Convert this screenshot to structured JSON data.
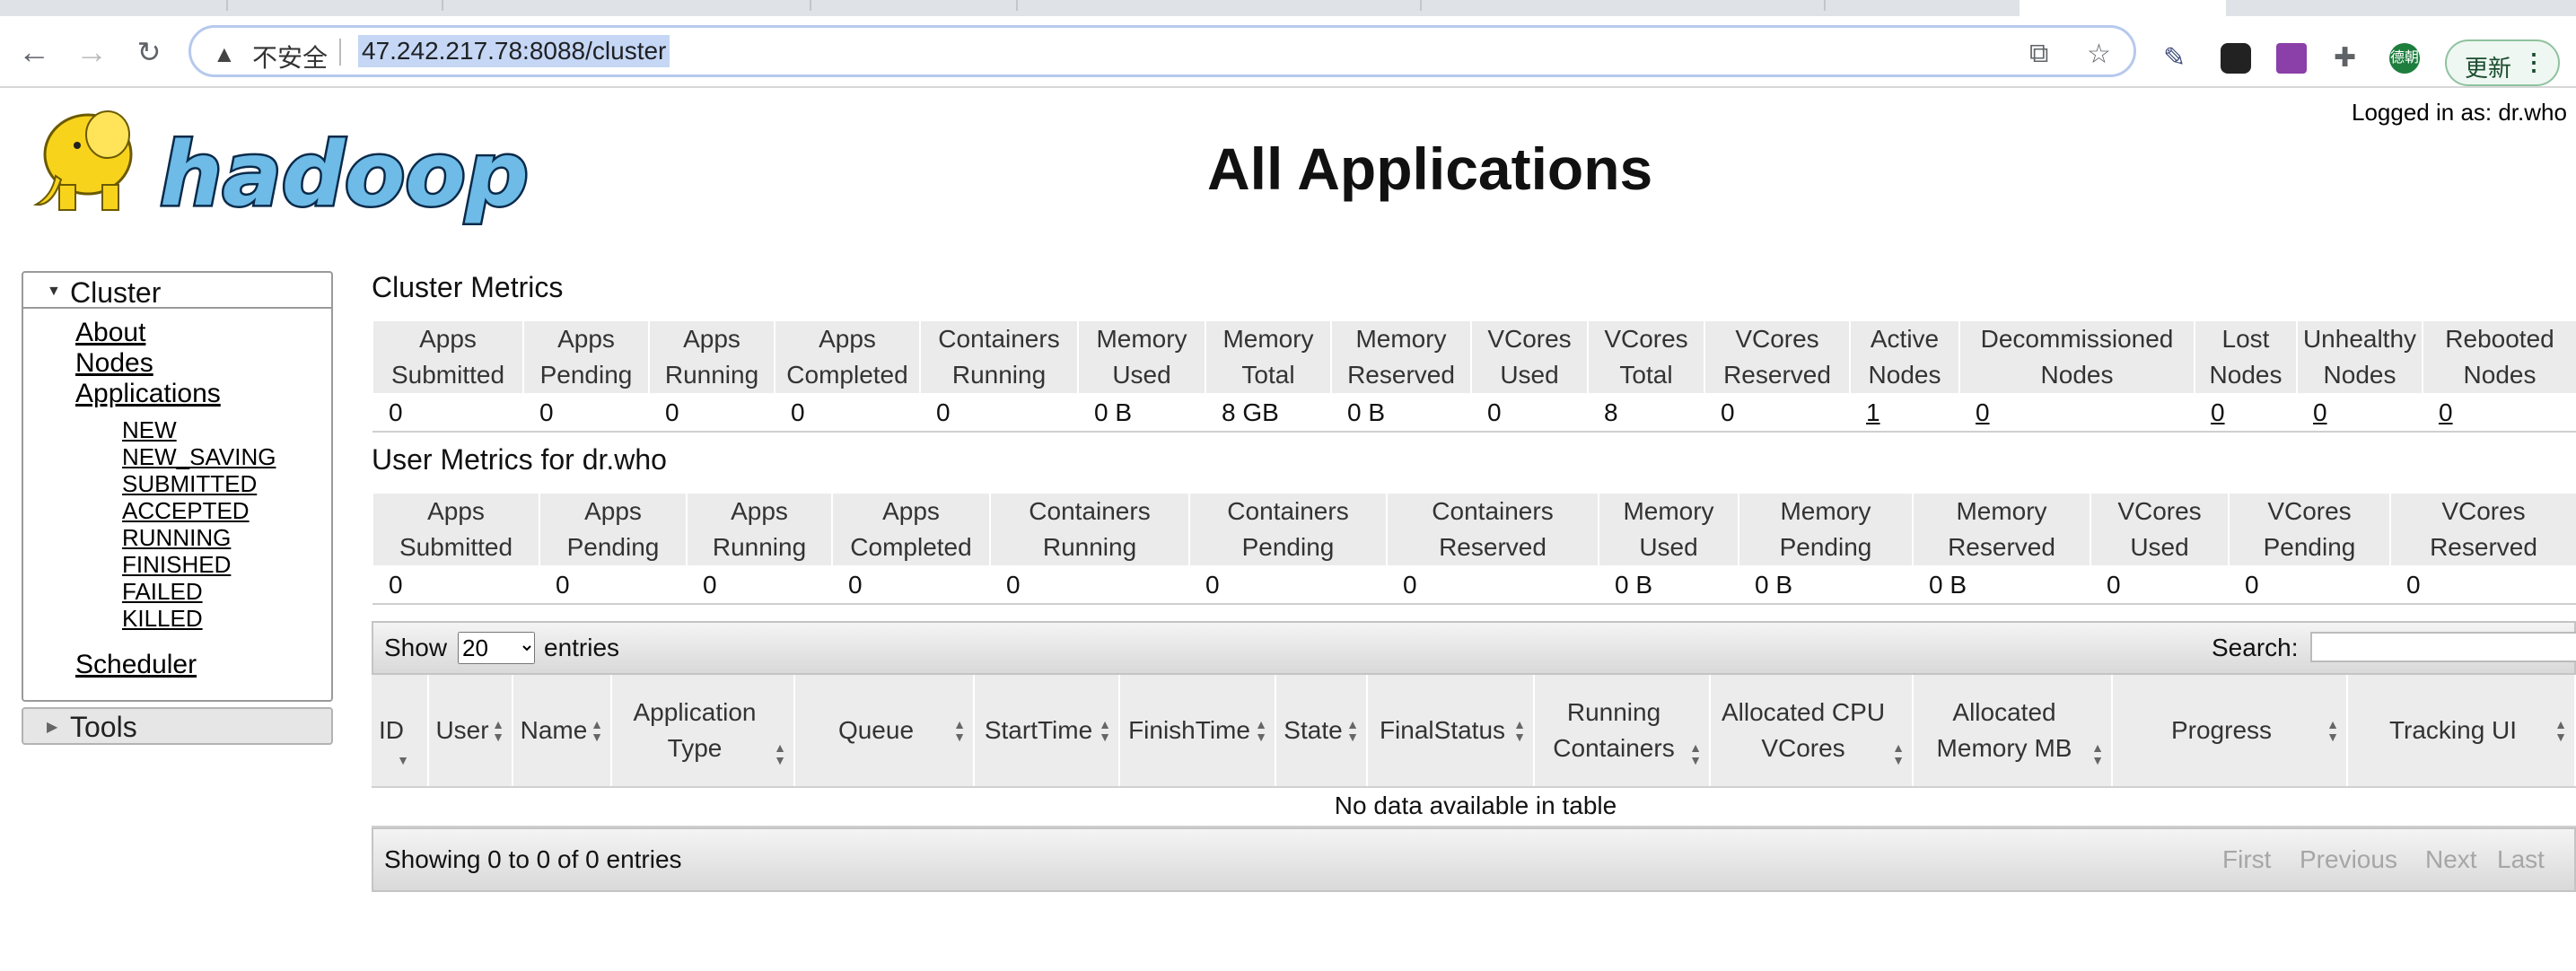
{
  "browser": {
    "insecure_label": "不安全",
    "url": "47.242.217.78:8088/cluster",
    "profile_label": "德朝",
    "update_label": "更新",
    "colors": {
      "omnibox_border": "#b6c9ee",
      "update_bg": "#eef7f1"
    }
  },
  "header": {
    "logged_in": "Logged in as: dr.who",
    "title": "All Applications",
    "logo_text": "hadoop"
  },
  "sidebar": {
    "cluster_label": "Cluster",
    "links": [
      "About",
      "Nodes",
      "Applications"
    ],
    "app_states": [
      "NEW",
      "NEW_SAVING",
      "SUBMITTED",
      "ACCEPTED",
      "RUNNING",
      "FINISHED",
      "FAILED",
      "KILLED"
    ],
    "scheduler": "Scheduler",
    "tools_label": "Tools"
  },
  "cluster_metrics": {
    "title": "Cluster Metrics",
    "headers": [
      "Apps\nSubmitted",
      "Apps\nPending",
      "Apps\nRunning",
      "Apps\nCompleted",
      "Containers\nRunning",
      "Memory\nUsed",
      "Memory\nTotal",
      "Memory\nReserved",
      "VCores\nUsed",
      "VCores\nTotal",
      "VCores\nReserved",
      "Active\nNodes",
      "Decommissioned\nNodes",
      "Lost\nNodes",
      "Unhealthy\nNodes",
      "Rebooted\nNodes"
    ],
    "values": [
      "0",
      "0",
      "0",
      "0",
      "0",
      "0 B",
      "8 GB",
      "0 B",
      "0",
      "8",
      "0",
      "1",
      "0",
      "0",
      "0",
      "0"
    ]
  },
  "user_metrics": {
    "title": "User Metrics for dr.who",
    "headers": [
      "Apps\nSubmitted",
      "Apps\nPending",
      "Apps\nRunning",
      "Apps\nCompleted",
      "Containers\nRunning",
      "Containers\nPending",
      "Containers\nReserved",
      "Memory\nUsed",
      "Memory\nPending",
      "Memory\nReserved",
      "VCores\nUsed",
      "VCores\nPending",
      "VCores\nReserved"
    ],
    "values": [
      "0",
      "0",
      "0",
      "0",
      "0",
      "0",
      "0",
      "0 B",
      "0 B",
      "0 B",
      "0",
      "0",
      "0"
    ]
  },
  "apps_table": {
    "show_label": "Show",
    "page_size": "20",
    "entries_label": "entries",
    "search_label": "Search:",
    "columns": [
      "ID",
      "User",
      "Name",
      "Application\nType",
      "Queue",
      "StartTime",
      "FinishTime",
      "State",
      "FinalStatus",
      "Running\nContainers",
      "Allocated CPU\nVCores",
      "Allocated\nMemory MB",
      "Progress",
      "Tracking UI"
    ],
    "empty_message": "No data available in table",
    "info": "Showing 0 to 0 of 0 entries",
    "pagination": [
      "First",
      "Previous",
      "Next",
      "Last"
    ]
  }
}
